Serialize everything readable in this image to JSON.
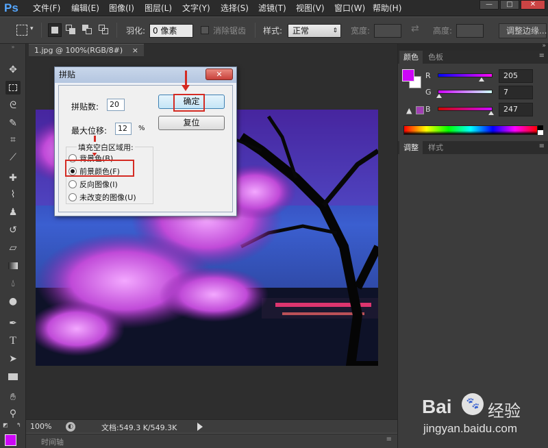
{
  "app": {
    "logo": "Ps"
  },
  "menubar": {
    "items": [
      "文件(F)",
      "编辑(E)",
      "图像(I)",
      "图层(L)",
      "文字(Y)",
      "选择(S)",
      "滤镜(T)",
      "视图(V)",
      "窗口(W)",
      "帮助(H)"
    ]
  },
  "window_controls": {
    "minimize": "—",
    "maximize": "□",
    "close": "✕"
  },
  "options": {
    "feather_label": "羽化:",
    "feather_value": "0 像素",
    "antialias_label": "消除锯齿",
    "style_label": "样式:",
    "style_value": "正常",
    "width_label": "宽度:",
    "height_label": "高度:",
    "refine_button": "调整边缘..."
  },
  "document": {
    "tab_label": "1.jpg @ 100%(RGB/8#)",
    "tab_close": "×"
  },
  "statusbar": {
    "zoom": "100%",
    "doc_info": "文档:549.3 K/549.3K"
  },
  "timeline": {
    "label": "时间轴"
  },
  "color_panel": {
    "tabs": [
      "颜色",
      "色板"
    ],
    "foreground_color": "#cd07f7",
    "channels": [
      {
        "label": "R",
        "value": "205",
        "fraction": 0.804
      },
      {
        "label": "G",
        "value": "7",
        "fraction": 0.027
      },
      {
        "label": "B",
        "value": "247",
        "fraction": 0.969
      }
    ]
  },
  "adjust_panel": {
    "tabs": [
      "调整",
      "样式"
    ]
  },
  "dialog": {
    "title": "拼贴",
    "close": "✕",
    "tiles_label": "拼贴数:",
    "tiles_value": "20",
    "offset_label": "最大位移:",
    "offset_value": "12",
    "offset_unit": "%",
    "ok_button": "确定",
    "reset_button": "复位",
    "fill_group_label": "填充空白区域用:",
    "options": [
      {
        "label": "背景色(B)",
        "checked": false
      },
      {
        "label": "前景颜色(F)",
        "checked": true
      },
      {
        "label": "反向图像(I)",
        "checked": false
      },
      {
        "label": "未改变的图像(U)",
        "checked": false
      }
    ]
  },
  "watermark": {
    "brand": "Bai",
    "brand_suffix": "经验",
    "url": "jingyan.baidu.com"
  }
}
